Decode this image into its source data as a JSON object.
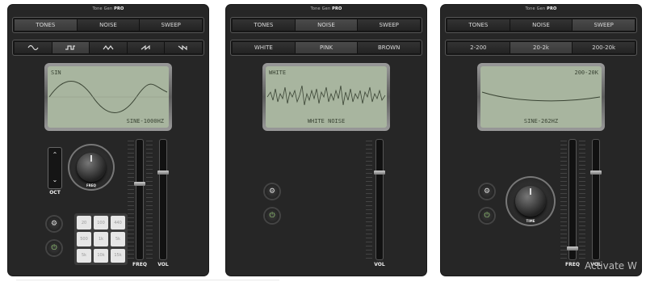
{
  "brand": {
    "prefix": "Tone Gen",
    "suffix": "PRO"
  },
  "panels": [
    {
      "mode_tabs": [
        "TONES",
        "NOISE",
        "SWEEP"
      ],
      "sub_icons": [
        "sine-wave-icon",
        "square-wave-icon",
        "triangle-wave-icon",
        "sawtooth-wave-icon",
        "reverse-sawtooth-wave-icon"
      ],
      "lcd": {
        "top_left": "SIN",
        "top_right": "",
        "bottom": "SINE-1000HZ"
      },
      "oct_label": "OCT",
      "freq_knob_label": "FREQ",
      "keypad": [
        "20",
        "100",
        "440",
        "500",
        "1k",
        "5k",
        "5k",
        "10k",
        "15k"
      ],
      "slider_labels": [
        "FREQ",
        "VOL"
      ],
      "gear": "⚙",
      "power": "⏻",
      "up": "⌃",
      "down": "⌄"
    },
    {
      "mode_tabs": [
        "TONES",
        "NOISE",
        "SWEEP"
      ],
      "sub_tabs": [
        "WHITE",
        "PINK",
        "BROWN"
      ],
      "lcd": {
        "top_left": "WHITE",
        "top_right": "",
        "bottom": "WHITE NOISE"
      },
      "slider_labels": [
        "VOL"
      ],
      "gear": "⚙",
      "power": "⏻"
    },
    {
      "mode_tabs": [
        "TONES",
        "NOISE",
        "SWEEP"
      ],
      "sub_tabs": [
        "2-200",
        "20-2k",
        "200-20k"
      ],
      "lcd": {
        "top_left": "",
        "top_right": "200-20K",
        "bottom": "SINE-262HZ"
      },
      "sweep_knob_label": "TIME",
      "slider_labels": [
        "FREQ",
        "VOL"
      ],
      "gear": "⚙",
      "power": "⏻"
    }
  ],
  "watermark": "Activate W"
}
